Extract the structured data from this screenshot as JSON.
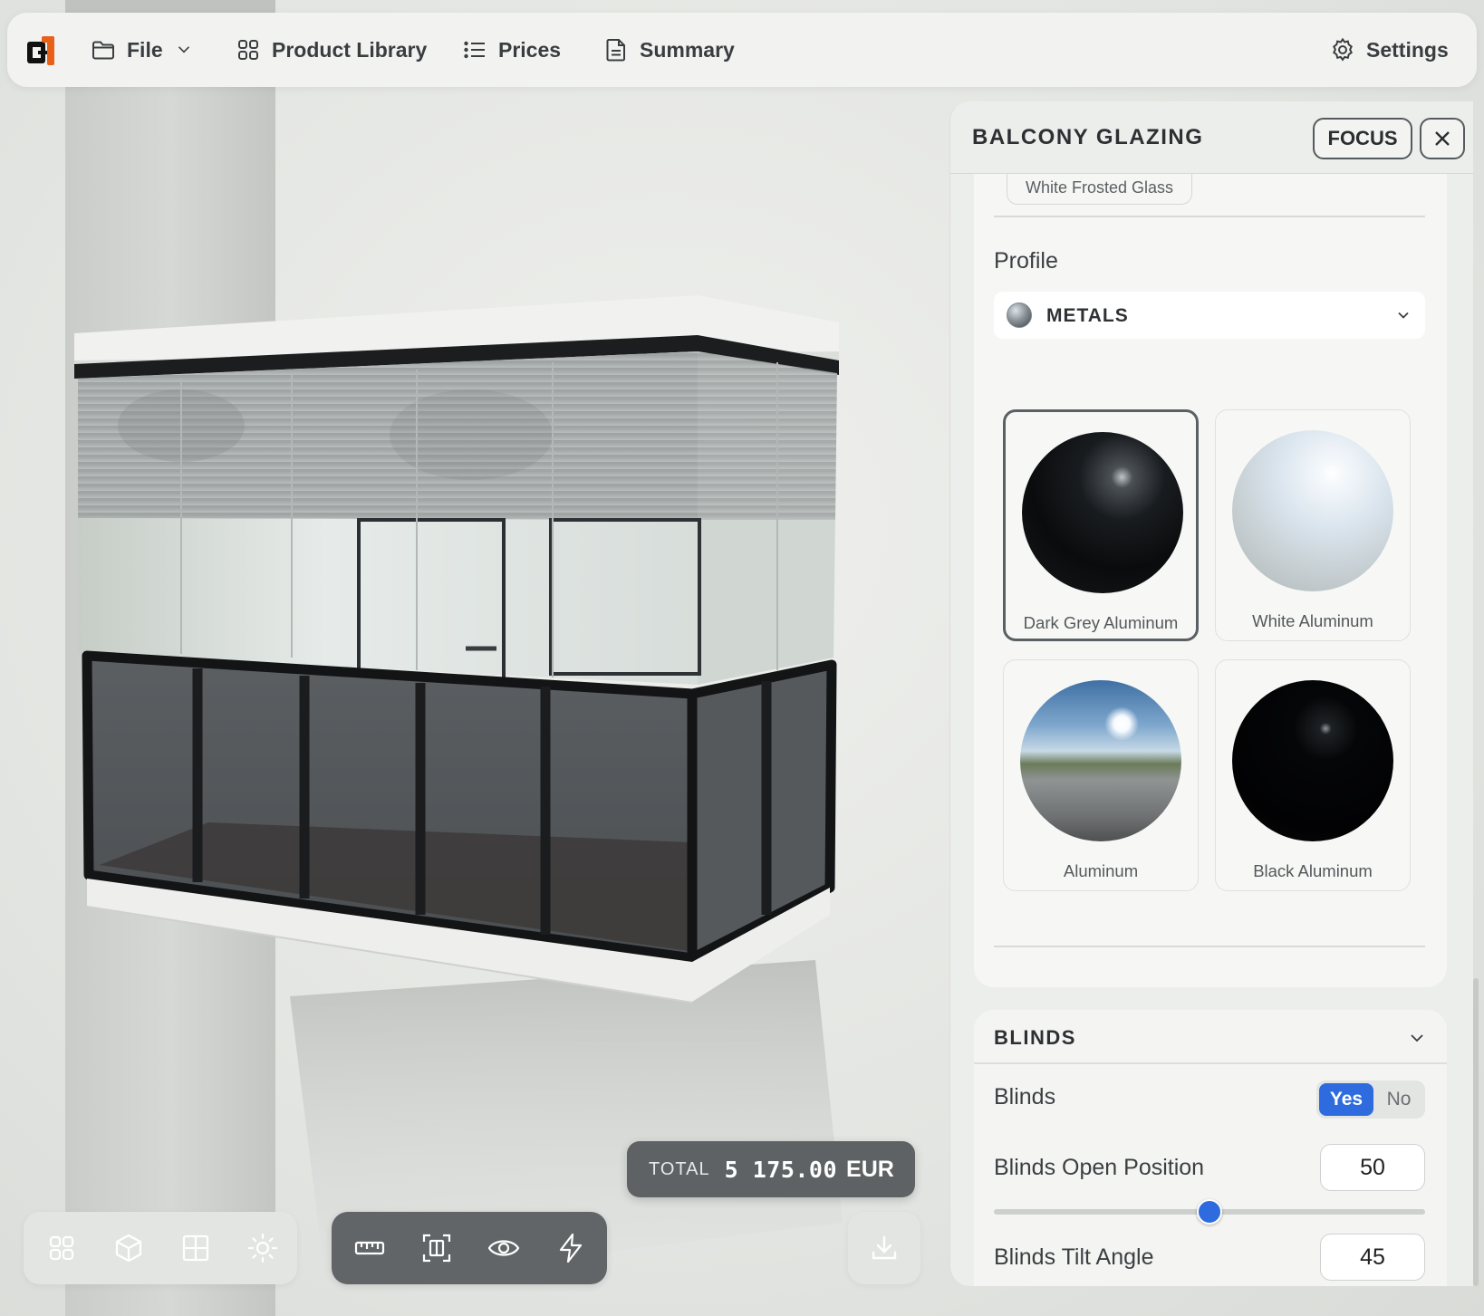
{
  "app": {
    "logo_text": "c1",
    "accent_color": "#2e6bde",
    "logo_accent_color": "#e8611a"
  },
  "topbar": {
    "file_label": "File",
    "library_label": "Product Library",
    "prices_label": "Prices",
    "summary_label": "Summary",
    "settings_label": "Settings"
  },
  "panel": {
    "title": "BALCONY GLAZING",
    "focus_label": "FOCUS",
    "glass_selected": "White Frosted Glass",
    "profile": {
      "label": "Profile",
      "family": "METALS",
      "options": [
        {
          "name": "Dark Grey Aluminum",
          "selected": true
        },
        {
          "name": "White Aluminum",
          "selected": false
        },
        {
          "name": "Aluminum",
          "selected": false
        },
        {
          "name": "Black Aluminum",
          "selected": false
        }
      ]
    },
    "blinds": {
      "section_title": "BLINDS",
      "blinds_label": "Blinds",
      "yes_label": "Yes",
      "no_label": "No",
      "open_position_label": "Blinds Open Position",
      "open_position_value": "50",
      "open_position_fraction": 0.5,
      "tilt_angle_label": "Blinds Tilt Angle",
      "tilt_angle_value": "45",
      "tilt_angle_fraction": 0.5
    }
  },
  "total": {
    "label": "TOTAL",
    "value": "5 175.00",
    "currency": "EUR"
  },
  "toolbar": {
    "view_icons": [
      "grid-icon",
      "cube-icon",
      "floorplan-icon",
      "sun-icon"
    ],
    "tool_icons": [
      "ruler-icon",
      "frame-icon",
      "eye-icon",
      "lightning-icon"
    ],
    "download_icon": "download-icon"
  }
}
